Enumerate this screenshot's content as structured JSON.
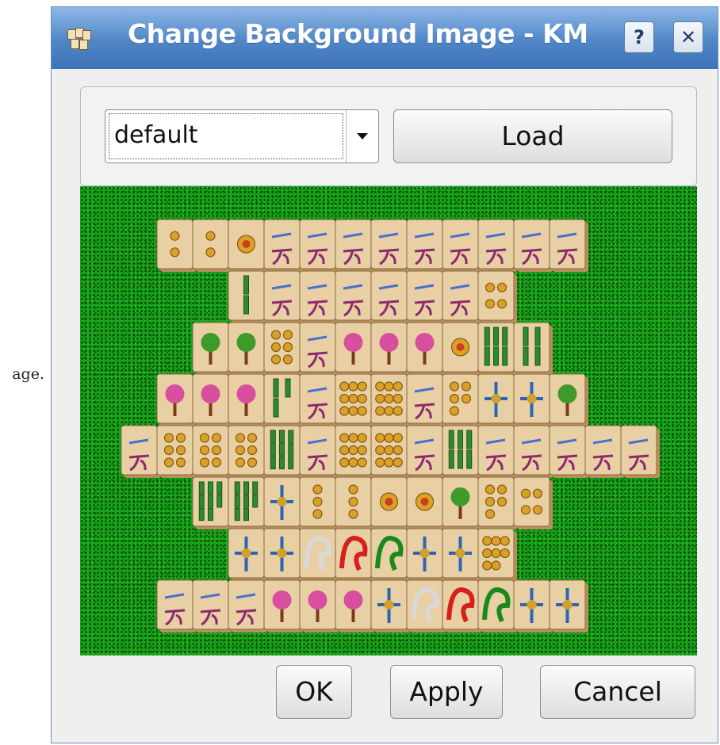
{
  "side_fragment": "age.",
  "window": {
    "title": "Change Background Image - KM",
    "help_label": "?",
    "close_label": "✕"
  },
  "background_selector": {
    "selected_value": "default",
    "load_label": "Load"
  },
  "preview": {
    "tile_face_color": "#e8cfa4",
    "tile_edge_color": "#b88f5d",
    "felt_color": "#17a317",
    "tiles": [
      {
        "row": 1,
        "col": 0,
        "face": "Circle 2"
      },
      {
        "row": 1,
        "col": 1,
        "face": "Circle 2"
      },
      {
        "row": 1,
        "col": 2,
        "face": "Circle 1"
      },
      {
        "row": 1,
        "col": 3,
        "face": "Character 9"
      },
      {
        "row": 1,
        "col": 4,
        "face": "Character 8"
      },
      {
        "row": 1,
        "col": 5,
        "face": "Character 7"
      },
      {
        "row": 1,
        "col": 6,
        "face": "Character 6"
      },
      {
        "row": 1,
        "col": 7,
        "face": "Character 5"
      },
      {
        "row": 1,
        "col": 8,
        "face": "Character 4"
      },
      {
        "row": 1,
        "col": 9,
        "face": "Character 3"
      },
      {
        "row": 1,
        "col": 10,
        "face": "Character 2"
      },
      {
        "row": 1,
        "col": 11,
        "face": "Character 1"
      },
      {
        "row": 2,
        "col": 2,
        "face": "Bamboo 2"
      },
      {
        "row": 2,
        "col": 3,
        "face": "Character 9"
      },
      {
        "row": 2,
        "col": 4,
        "face": "Character 8"
      },
      {
        "row": 2,
        "col": 5,
        "face": "Character 7"
      },
      {
        "row": 2,
        "col": 6,
        "face": "Character 6"
      },
      {
        "row": 2,
        "col": 7,
        "face": "Character 5"
      },
      {
        "row": 2,
        "col": 8,
        "face": "Character 4"
      },
      {
        "row": 2,
        "col": 9,
        "face": "Circle 4"
      },
      {
        "row": 3,
        "col": 1,
        "face": "Tree"
      },
      {
        "row": 3,
        "col": 2,
        "face": "Tree"
      },
      {
        "row": 3,
        "col": 3,
        "face": "Circle 6"
      },
      {
        "row": 3,
        "col": 4,
        "face": "Character 1"
      },
      {
        "row": 3,
        "col": 5,
        "face": "Mum"
      },
      {
        "row": 3,
        "col": 6,
        "face": "Plum"
      },
      {
        "row": 3,
        "col": 7,
        "face": "Orchid"
      },
      {
        "row": 3,
        "col": 8,
        "face": "Circle 1"
      },
      {
        "row": 3,
        "col": 9,
        "face": "Bamboo 6"
      },
      {
        "row": 3,
        "col": 10,
        "face": "Bamboo 4"
      },
      {
        "row": 4,
        "col": 0,
        "face": "Mum"
      },
      {
        "row": 4,
        "col": 1,
        "face": "Plum"
      },
      {
        "row": 4,
        "col": 2,
        "face": "Orchid"
      },
      {
        "row": 4,
        "col": 3,
        "face": "Bamboo 3"
      },
      {
        "row": 4,
        "col": 4,
        "face": "Character 5"
      },
      {
        "row": 4,
        "col": 5,
        "face": "Circle 9"
      },
      {
        "row": 4,
        "col": 6,
        "face": "Circle 9"
      },
      {
        "row": 4,
        "col": 7,
        "face": "Character 2"
      },
      {
        "row": 4,
        "col": 8,
        "face": "Circle 5"
      },
      {
        "row": 4,
        "col": 9,
        "face": "South"
      },
      {
        "row": 4,
        "col": 10,
        "face": "North"
      },
      {
        "row": 4,
        "col": 11,
        "face": "Tree"
      },
      {
        "row": 5,
        "col": -1,
        "face": "Character 3"
      },
      {
        "row": 5,
        "col": 0,
        "face": "Circle 6"
      },
      {
        "row": 5,
        "col": 1,
        "face": "Circle 6"
      },
      {
        "row": 5,
        "col": 2,
        "face": "Circle 6"
      },
      {
        "row": 5,
        "col": 3,
        "face": "Bamboo 9"
      },
      {
        "row": 5,
        "col": 4,
        "face": "Character 9"
      },
      {
        "row": 5,
        "col": 5,
        "face": "Circle 9"
      },
      {
        "row": 5,
        "col": 6,
        "face": "Circle 9"
      },
      {
        "row": 5,
        "col": 7,
        "face": "Character 6"
      },
      {
        "row": 5,
        "col": 8,
        "face": "Bamboo 6"
      },
      {
        "row": 5,
        "col": 9,
        "face": "Character 6"
      },
      {
        "row": 5,
        "col": 10,
        "face": "Character 5"
      },
      {
        "row": 5,
        "col": 11,
        "face": "Character 4"
      },
      {
        "row": 5,
        "col": 12,
        "face": "Character 2"
      },
      {
        "row": 5,
        "col": 13,
        "face": "Character 1"
      },
      {
        "row": 6,
        "col": 1,
        "face": "Bamboo 8"
      },
      {
        "row": 6,
        "col": 2,
        "face": "Bamboo 8"
      },
      {
        "row": 6,
        "col": 3,
        "face": "South"
      },
      {
        "row": 6,
        "col": 4,
        "face": "Circle 3"
      },
      {
        "row": 6,
        "col": 5,
        "face": "Circle 3"
      },
      {
        "row": 6,
        "col": 6,
        "face": "Circle 1"
      },
      {
        "row": 6,
        "col": 7,
        "face": "Circle 1"
      },
      {
        "row": 6,
        "col": 8,
        "face": "Tree"
      },
      {
        "row": 6,
        "col": 9,
        "face": "Circle 5"
      },
      {
        "row": 6,
        "col": 10,
        "face": "Circle 4"
      },
      {
        "row": 7,
        "col": 2,
        "face": "South"
      },
      {
        "row": 7,
        "col": 3,
        "face": "Bamboo"
      },
      {
        "row": 7,
        "col": 4,
        "face": "White Dragon"
      },
      {
        "row": 7,
        "col": 5,
        "face": "Red Dragon"
      },
      {
        "row": 7,
        "col": 6,
        "face": "Green Dragon"
      },
      {
        "row": 7,
        "col": 7,
        "face": "West"
      },
      {
        "row": 7,
        "col": 8,
        "face": "East"
      },
      {
        "row": 7,
        "col": 9,
        "face": "Circle 8"
      },
      {
        "row": 8,
        "col": 0,
        "face": "Character 3"
      },
      {
        "row": 8,
        "col": 1,
        "face": "Character 2"
      },
      {
        "row": 8,
        "col": 2,
        "face": "Character 1"
      },
      {
        "row": 8,
        "col": 3,
        "face": "Mum"
      },
      {
        "row": 8,
        "col": 4,
        "face": "Plum"
      },
      {
        "row": 8,
        "col": 5,
        "face": "Orchid"
      },
      {
        "row": 8,
        "col": 6,
        "face": "Bamboo"
      },
      {
        "row": 8,
        "col": 7,
        "face": "White Dragon"
      },
      {
        "row": 8,
        "col": 8,
        "face": "Red Dragon"
      },
      {
        "row": 8,
        "col": 9,
        "face": "Green Dragon"
      },
      {
        "row": 8,
        "col": 10,
        "face": "West"
      },
      {
        "row": 8,
        "col": 11,
        "face": "East"
      }
    ]
  },
  "buttons": {
    "ok_label": "OK",
    "apply_label": "Apply",
    "cancel_label": "Cancel"
  }
}
